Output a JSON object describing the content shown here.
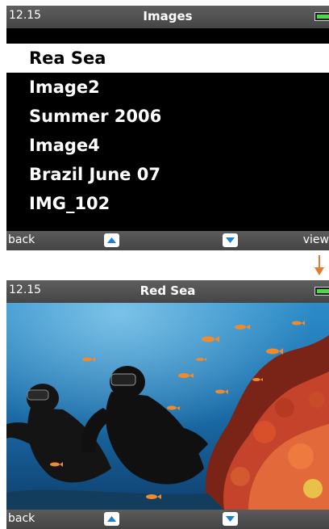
{
  "screen1": {
    "status": {
      "time": "12.15",
      "title": "Images"
    },
    "list": {
      "items": [
        {
          "label": "Rea Sea",
          "selected": true
        },
        {
          "label": "Image2"
        },
        {
          "label": "Summer 2006"
        },
        {
          "label": "Image4"
        },
        {
          "label": "Brazil June 07"
        },
        {
          "label": "IMG_102"
        }
      ]
    },
    "softkeys": {
      "left": "back",
      "right": "view"
    }
  },
  "screen2": {
    "status": {
      "time": "12.15",
      "title": "Red Sea"
    },
    "softkeys": {
      "left": "back"
    }
  },
  "colors": {
    "battery": "#4fd64a",
    "nav_button": "#1f7fd1",
    "transition_arrow": "#e8782a",
    "photo_water": "#1d73b0",
    "coral": "#d8502a"
  },
  "icons": {
    "up": "triangle-up-icon",
    "down": "triangle-down-icon",
    "battery": "battery-icon",
    "arrow": "arrow-down-icon"
  }
}
